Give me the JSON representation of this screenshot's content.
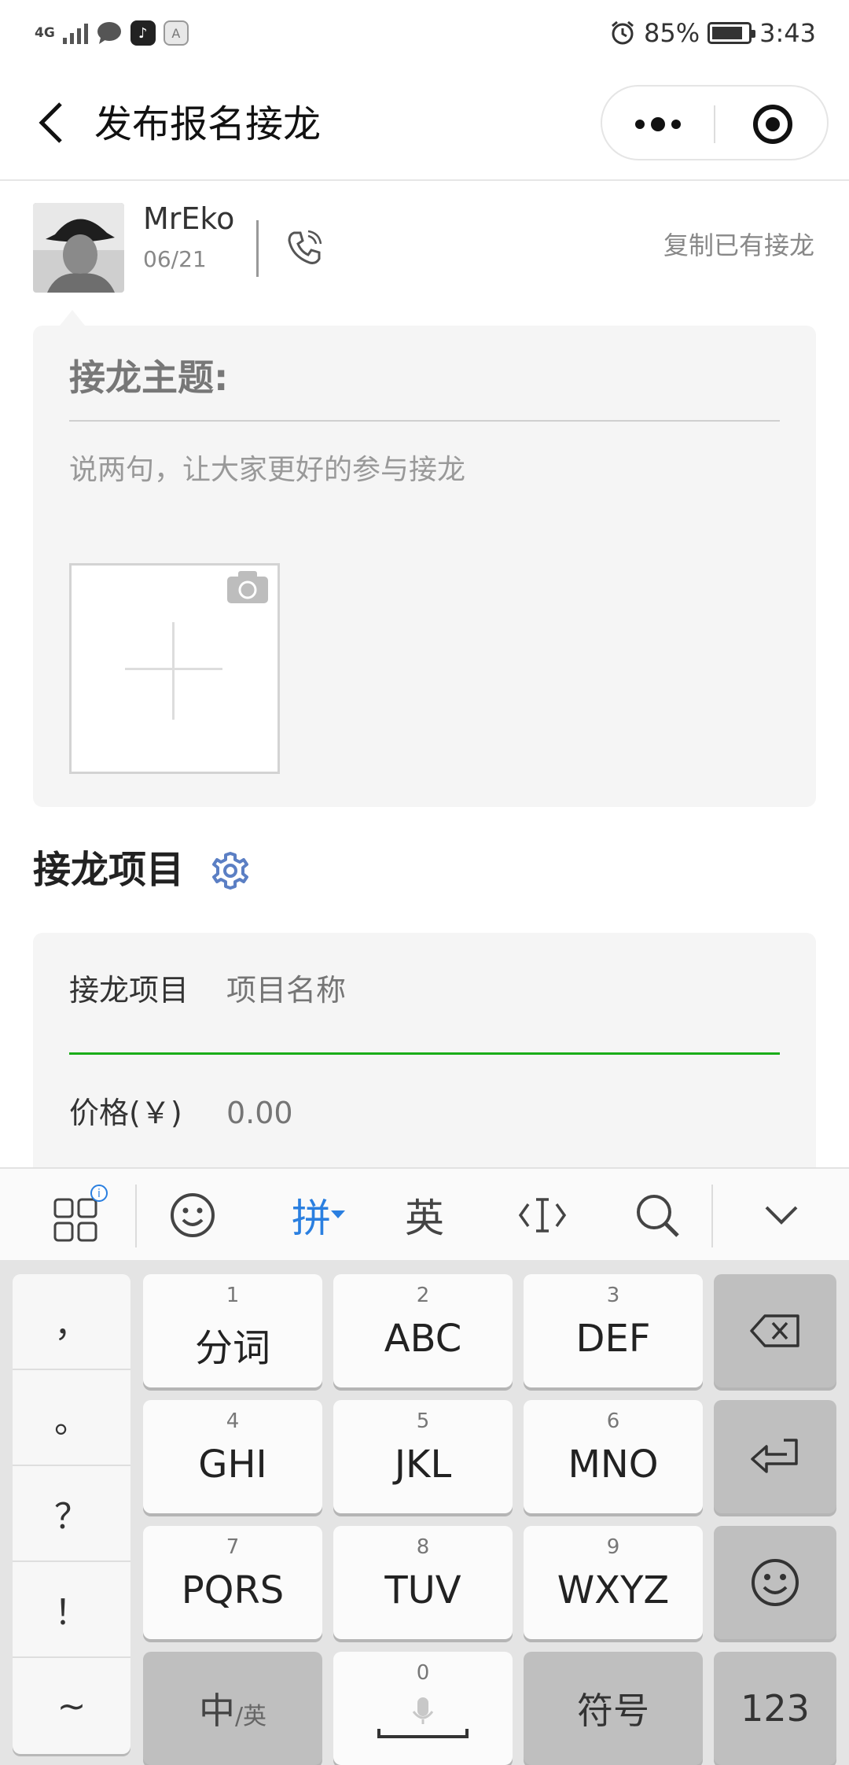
{
  "status_bar": {
    "network": "4G",
    "battery_percent": "85%",
    "battery_level": 0.85,
    "time": "3:43",
    "icons": [
      "signal-icon",
      "message-icon",
      "tiktok-icon",
      "keyboard-a-icon",
      "alarm-icon",
      "battery-icon"
    ]
  },
  "nav": {
    "title": "发布报名接龙",
    "back_icon": "back-arrow-icon",
    "more_icon": "more-dots-icon",
    "close_icon": "miniprogram-close-icon"
  },
  "user": {
    "name": "MrEko",
    "date": "06/21",
    "copy_label": "复制已有接龙"
  },
  "topic_card": {
    "title_label": "接龙主题:",
    "description_placeholder": "说两句，让大家更好的参与接龙"
  },
  "items_section": {
    "title": "接龙项目",
    "item_label": "接龙项目",
    "item_placeholder": "项目名称",
    "price_label": "价格(￥)",
    "price_placeholder": "0.00"
  },
  "keyboard_toolbar": {
    "pinyin": "拼",
    "english": "英"
  },
  "keyboard": {
    "symbols": [
      "，",
      "。",
      "？",
      "！",
      "~"
    ],
    "rows": [
      [
        {
          "num": "1",
          "label": "分词"
        },
        {
          "num": "2",
          "label": "ABC"
        },
        {
          "num": "3",
          "label": "DEF"
        }
      ],
      [
        {
          "num": "4",
          "label": "GHI"
        },
        {
          "num": "5",
          "label": "JKL"
        },
        {
          "num": "6",
          "label": "MNO"
        }
      ],
      [
        {
          "num": "7",
          "label": "PQRS"
        },
        {
          "num": "8",
          "label": "TUV"
        },
        {
          "num": "9",
          "label": "WXYZ"
        }
      ]
    ],
    "zh_label": "中",
    "en_sub": "/英",
    "space_num": "0",
    "symbol_label": "符号",
    "numeric_label": "123"
  },
  "colors": {
    "accent_green": "#1aad19",
    "accent_blue": "#2a7fe0",
    "card_bg": "#f5f5f5"
  }
}
